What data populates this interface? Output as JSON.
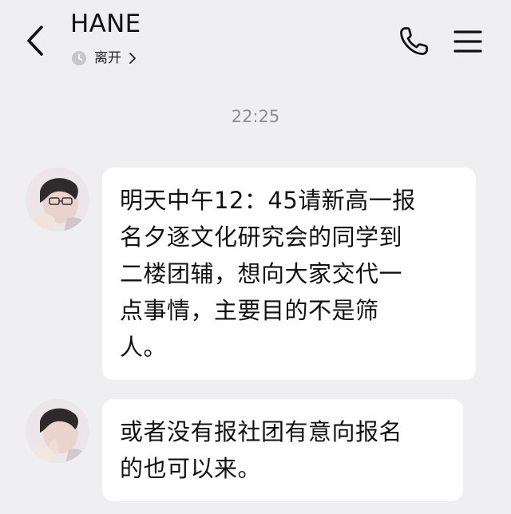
{
  "header": {
    "back_icon": "chevron-left-icon",
    "contact_name": "HANE",
    "presence_status": "离开",
    "presence_icon": "clock-icon",
    "call_icon": "phone-icon",
    "menu_icon": "hamburger-menu-icon"
  },
  "conversation": {
    "timestamp": "22:25",
    "messages": [
      {
        "sender": "HANE",
        "text_lines": [
          "明天中午12：45请新高一报",
          "名夕逐文化研究会的同学到",
          "二楼团辅，想向大家交代一",
          "点事情，主要目的不是筛",
          "人。"
        ]
      },
      {
        "sender": "HANE",
        "text_lines": [
          "或者没有报社团有意向报名",
          "的也可以来。"
        ]
      }
    ]
  },
  "colors": {
    "background": "#efeff1",
    "bubble": "#ffffff",
    "text": "#111111",
    "timestamp": "#8e8e93"
  }
}
